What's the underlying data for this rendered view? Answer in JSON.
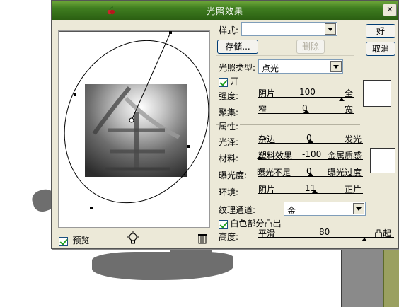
{
  "dialog": {
    "title": "光照效果"
  },
  "buttons": {
    "ok": "好",
    "cancel": "取消",
    "save": "存储...",
    "delete": "删除"
  },
  "style": {
    "label": "样式:",
    "value": ""
  },
  "light": {
    "type_label": "光照类型:",
    "type_value": "点光",
    "on_label": "开",
    "intensity": {
      "label": "强度:",
      "left": "阴片",
      "value": "100",
      "right": "全"
    },
    "focus": {
      "label": "聚集:",
      "left": "窄",
      "value": "0",
      "right": "宽"
    }
  },
  "properties": {
    "title": "属性:",
    "gloss": {
      "label": "光泽:",
      "left": "杂边",
      "value": "0",
      "right": "发光"
    },
    "material": {
      "label": "材料:",
      "left": "塑料效果",
      "value": "-100",
      "right": "金属质感"
    },
    "exposure": {
      "label": "曝光度:",
      "left": "曝光不足",
      "value": "0",
      "right": "曝光过度"
    },
    "ambience": {
      "label": "环境:",
      "left": "阴片",
      "value": "11",
      "right": "正片"
    }
  },
  "texture": {
    "channel_label": "纹理通道:",
    "channel_value": "金",
    "white_high_label": "白色部分凸出",
    "height": {
      "label": "高度:",
      "left": "平滑",
      "value": "80",
      "right": "凸起"
    }
  },
  "preview": {
    "label": "预览",
    "glyph": "金"
  },
  "icons": {
    "app": "cherry-icon",
    "close": "close-icon",
    "light_bulb": "light-bulb-icon",
    "trash": "trash-icon"
  }
}
